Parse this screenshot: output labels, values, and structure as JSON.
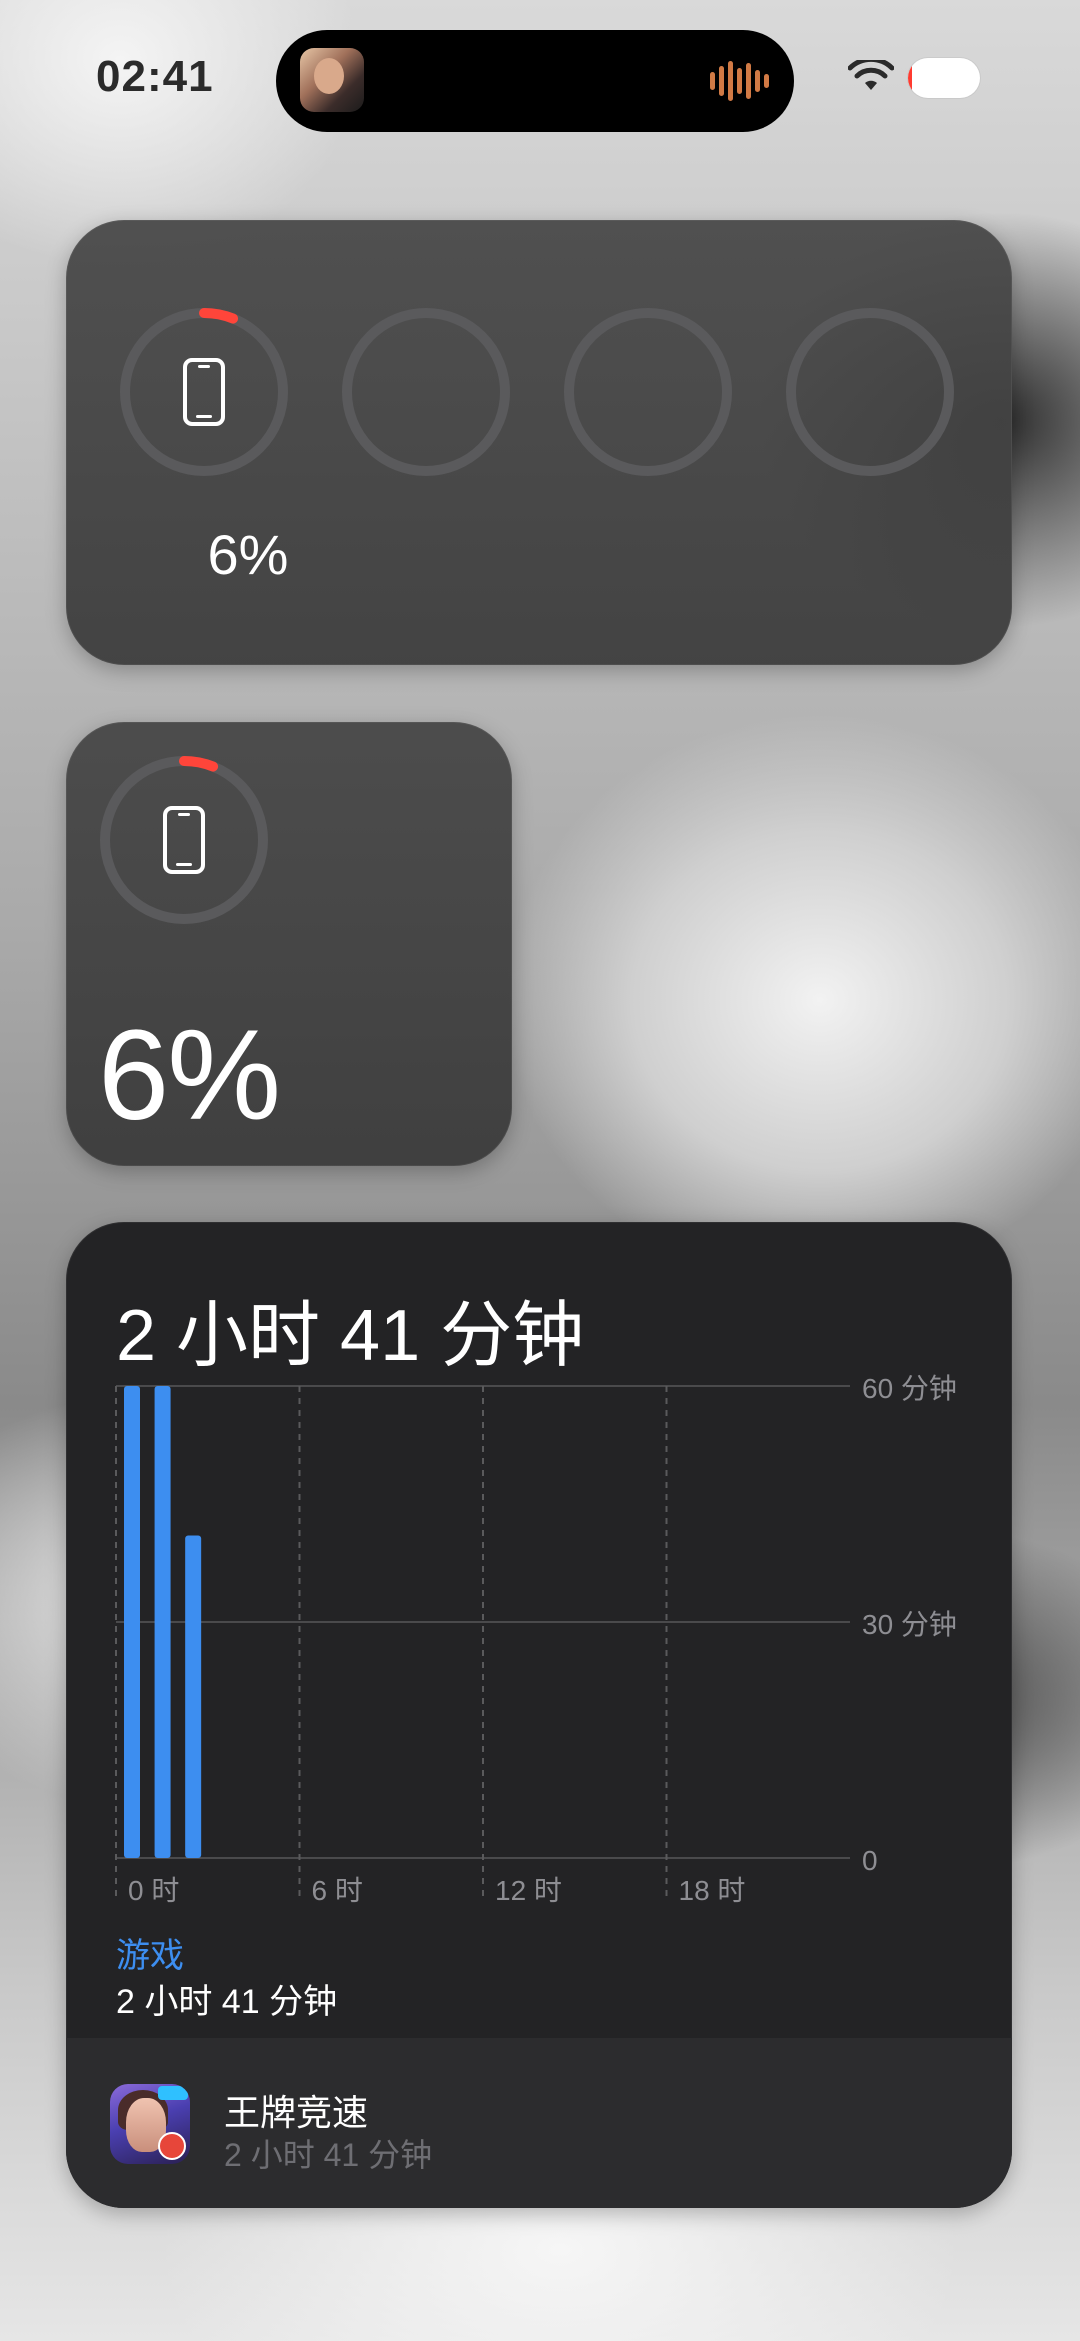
{
  "status_bar": {
    "time": "02:41",
    "battery_percent": "6",
    "battery_level": 0.06,
    "wifi_icon": "wifi-icon"
  },
  "dynamic_island": {
    "activity_icon": "music-waveform-icon",
    "waveform_color": "#d17a45"
  },
  "battery_widget_wide": {
    "device_icon": "iphone-icon",
    "percent_label": "6%",
    "level": 0.06,
    "empty_slots": 3
  },
  "battery_widget_small": {
    "device_icon": "iphone-icon",
    "percent_label": "6%",
    "level": 0.06
  },
  "screen_time_widget": {
    "total": "2 小时 41 分钟",
    "category_label": "游戏",
    "category_time": "2 小时 41 分钟",
    "app_name": "王牌竞速",
    "app_time": "2 小时 41 分钟"
  },
  "colors": {
    "accent_blue": "#3d8ef0",
    "battery_red": "#ff453a",
    "ring_track": "#5a5a5c"
  },
  "chart_data": {
    "type": "bar",
    "x": [
      0,
      1,
      2
    ],
    "values": [
      60,
      60,
      41
    ],
    "x_tick_labels": [
      "0 时",
      "6 时",
      "12 时",
      "18 时"
    ],
    "y_tick_labels": [
      "60 分钟",
      "30 分钟",
      "0"
    ],
    "ylim": [
      0,
      60
    ],
    "xlim": [
      0,
      24
    ],
    "unit": "分钟",
    "grid": true,
    "series_color": "#3d8ef0"
  }
}
